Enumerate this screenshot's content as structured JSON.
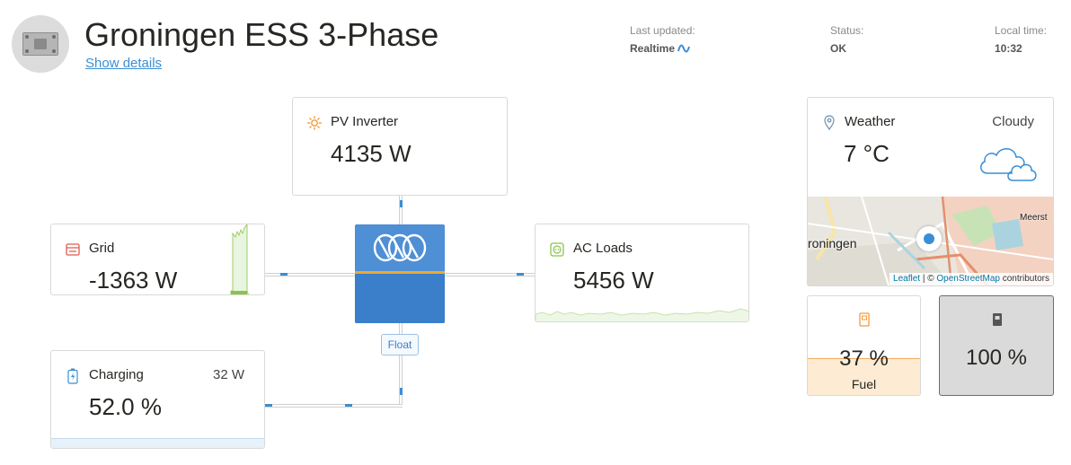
{
  "header": {
    "title": "Groningen ESS 3-Phase",
    "details_link": "Show details",
    "last_updated_label": "Last updated:",
    "last_updated_value": "Realtime",
    "status_label": "Status:",
    "status_value": "OK",
    "local_time_label": "Local time:",
    "local_time_value": "10:32"
  },
  "pv_inverter": {
    "title": "PV Inverter",
    "value": "4135 W",
    "icon": "sun-icon"
  },
  "grid": {
    "title": "Grid",
    "value": "-1363 W",
    "icon": "grid-meter-icon"
  },
  "ac_loads": {
    "title": "AC Loads",
    "value": "5456 W",
    "icon": "socket-icon"
  },
  "battery": {
    "title": "Charging",
    "power": "32 W",
    "value": "52.0 %",
    "soc_fraction": 0.52,
    "icon": "battery-charging-icon"
  },
  "inverter": {
    "state": "Float",
    "icon": "victron-logo-icon"
  },
  "weather": {
    "title": "Weather",
    "temperature": "7 °C",
    "condition": "Cloudy",
    "icon": "location-pin-icon"
  },
  "map": {
    "place_label": "roningen",
    "place_label_2": "Meerst",
    "attribution_leaflet": "Leaflet",
    "attribution_sep": " | © ",
    "attribution_osm": "OpenStreetMap",
    "attribution_suffix": " contributors"
  },
  "tanks": [
    {
      "name": "Fuel",
      "value": "37 %",
      "level": 0.37,
      "icon": "fuel-tank-icon"
    },
    {
      "name": "",
      "value": "100 %",
      "level": 1.0,
      "icon": "tank-icon"
    }
  ],
  "colors": {
    "accent_blue": "#3b8ed3",
    "inverter_blue": "#4e8fd5",
    "stripe_orange": "#f0a830",
    "grid_red": "#e05a4f",
    "pv_orange": "#f29a3a",
    "loads_green": "#8bc34a",
    "fuel_fill": "#fdebd3"
  }
}
